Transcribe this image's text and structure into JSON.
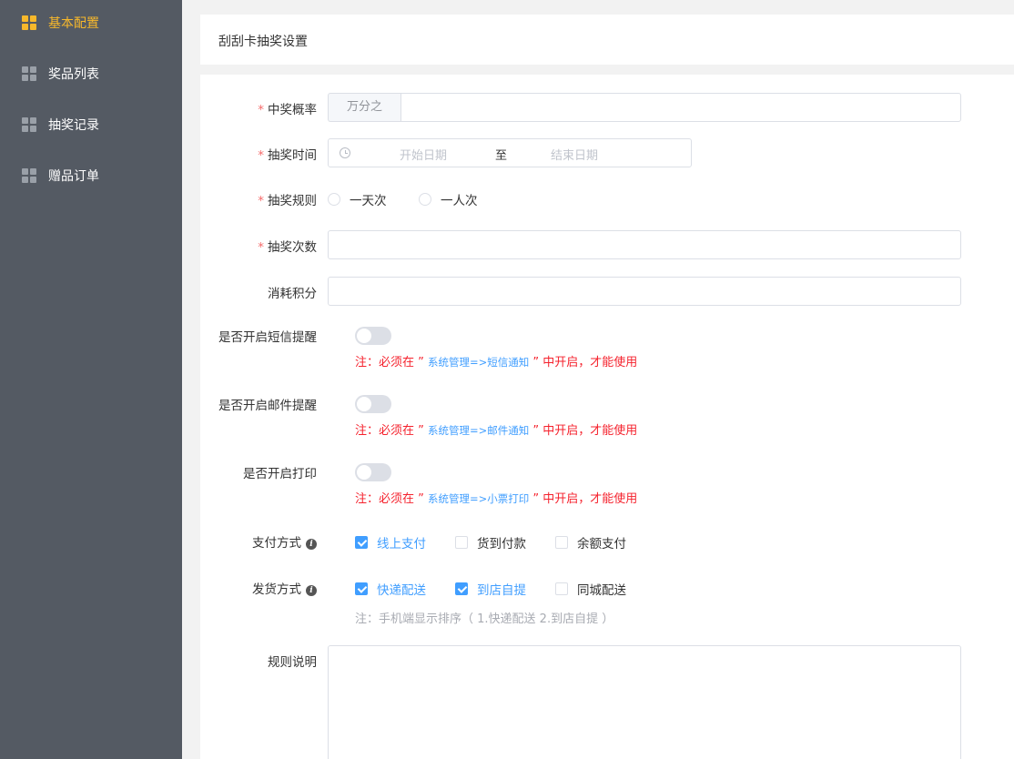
{
  "sidebar": {
    "items": [
      {
        "label": "基本配置",
        "active": true
      },
      {
        "label": "奖品列表",
        "active": false
      },
      {
        "label": "抽奖记录",
        "active": false
      },
      {
        "label": "赠品订单",
        "active": false
      }
    ]
  },
  "header": {
    "title": "刮刮卡抽奖设置"
  },
  "form": {
    "probability": {
      "label": "中奖概率",
      "prefix": "万分之",
      "value": ""
    },
    "time": {
      "label": "抽奖时间",
      "start_placeholder": "开始日期",
      "separator": "至",
      "end_placeholder": "结束日期"
    },
    "rule": {
      "label": "抽奖规则",
      "options": [
        "一天次",
        "一人次"
      ]
    },
    "count": {
      "label": "抽奖次数",
      "value": ""
    },
    "points": {
      "label": "消耗积分",
      "value": ""
    },
    "sms": {
      "label": "是否开启短信提醒",
      "enabled": false,
      "note_prefix": "注：必须在 ” ",
      "note_link": "系统管理=>短信通知",
      "note_suffix": " ” 中开启，才能使用"
    },
    "email": {
      "label": "是否开启邮件提醒",
      "enabled": false,
      "note_prefix": "注：必须在 ” ",
      "note_link": "系统管理=>邮件通知",
      "note_suffix": " ” 中开启，才能使用"
    },
    "print": {
      "label": "是否开启打印",
      "enabled": false,
      "note_prefix": "注：必须在 ” ",
      "note_link": "系统管理=>小票打印",
      "note_suffix": " ” 中开启，才能使用"
    },
    "payment": {
      "label": "支付方式",
      "options": [
        {
          "label": "线上支付",
          "checked": true
        },
        {
          "label": "货到付款",
          "checked": false
        },
        {
          "label": "余额支付",
          "checked": false
        }
      ]
    },
    "delivery": {
      "label": "发货方式",
      "options": [
        {
          "label": "快递配送",
          "checked": true
        },
        {
          "label": "到店自提",
          "checked": true
        },
        {
          "label": "同城配送",
          "checked": false
        }
      ],
      "note": "注：手机端显示排序（ 1.快递配送 2.到店自提 ）"
    },
    "description": {
      "label": "规则说明",
      "value": ""
    }
  },
  "colors": {
    "accent": "#409eff",
    "sidebar_bg": "#545a63",
    "active": "#f7b82b",
    "required": "#f56c6c",
    "warning": "#f5222d"
  }
}
